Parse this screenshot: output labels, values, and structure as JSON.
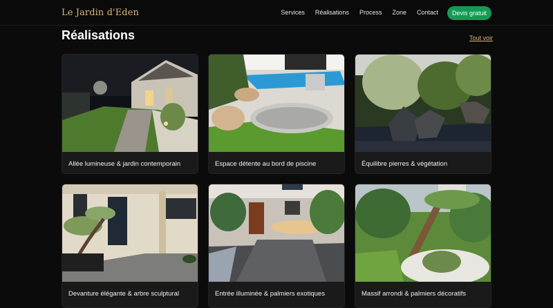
{
  "brand": "Le Jardin d'Eden",
  "nav": [
    "Services",
    "Réalisations",
    "Process",
    "Zone",
    "Contact"
  ],
  "cta": "Devis gratuit",
  "section": {
    "title": "Réalisations",
    "see_all": "Tout voir"
  },
  "projects": [
    {
      "title": "Allée lumineuse & jardin contemporain",
      "image": "night-garden-path-photo"
    },
    {
      "title": "Espace détente au bord de piscine",
      "image": "pool-garden-photo"
    },
    {
      "title": "Équilibre pierres & végétation",
      "image": "rocks-plants-photo"
    },
    {
      "title": "Devanture élégante & arbre sculptural",
      "image": "facade-bonsai-photo"
    },
    {
      "title": "Entrée illuminée & palmiers exotiques",
      "image": "lit-entrance-palms-photo"
    },
    {
      "title": "Massif arrondi & palmiers décoratifs",
      "image": "round-bed-palms-photo"
    }
  ],
  "colors": {
    "accent": "#d9b77d",
    "cta": "#159a53",
    "background": "#0b0b0b",
    "card": "#1a1a1a"
  }
}
